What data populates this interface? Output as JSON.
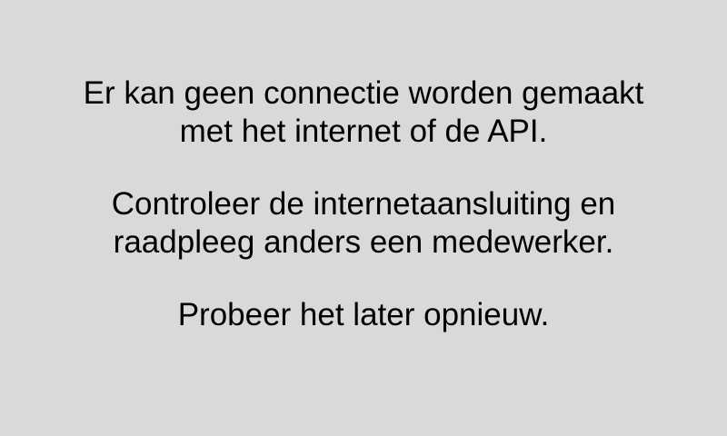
{
  "error_screen": {
    "connection_message": {
      "line1": "Er kan geen connectie worden gemaakt",
      "line2": "met het internet of de API."
    },
    "advice_message": {
      "line1": "Controleer de internetaansluiting en",
      "line2": "raadpleeg anders een medewerker."
    },
    "retry_message": {
      "line1": "Probeer het later opnieuw."
    },
    "colors": {
      "background": "#d9d9d9",
      "text": "#000000"
    }
  }
}
